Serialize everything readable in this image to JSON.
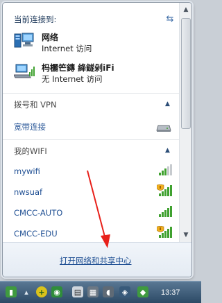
{
  "flyout": {
    "connected_header": "当前连接到:",
    "networks": [
      {
        "name": "网络",
        "status": "Internet 访问",
        "icon": "network-icon"
      },
      {
        "name": "杩欐笀鏄    絳鐩剁iFi",
        "status": "无 Internet 访问",
        "icon": "wireless-network-icon"
      }
    ]
  },
  "dialup": {
    "header": "拨号和 VPN",
    "items": [
      {
        "label": "宽带连接",
        "icon": "broadband-icon"
      }
    ]
  },
  "wifi": {
    "header": "我的WIFI",
    "networks": [
      {
        "ssid": "mywifi",
        "signal": 3,
        "secured": false
      },
      {
        "ssid": "nwsuaf",
        "signal": 5,
        "secured": true
      },
      {
        "ssid": "CMCC-AUTO",
        "signal": 5,
        "secured": false
      },
      {
        "ssid": "CMCC-EDU",
        "signal": 5,
        "secured": true
      }
    ]
  },
  "footer": {
    "open_center_label": "打开网络和共享中心"
  },
  "taskbar": {
    "clock": "13:37"
  },
  "colors": {
    "link": "#1f4f93",
    "header": "#1e395b",
    "signal": "#3fa12f",
    "annotation": "#e8201a"
  }
}
